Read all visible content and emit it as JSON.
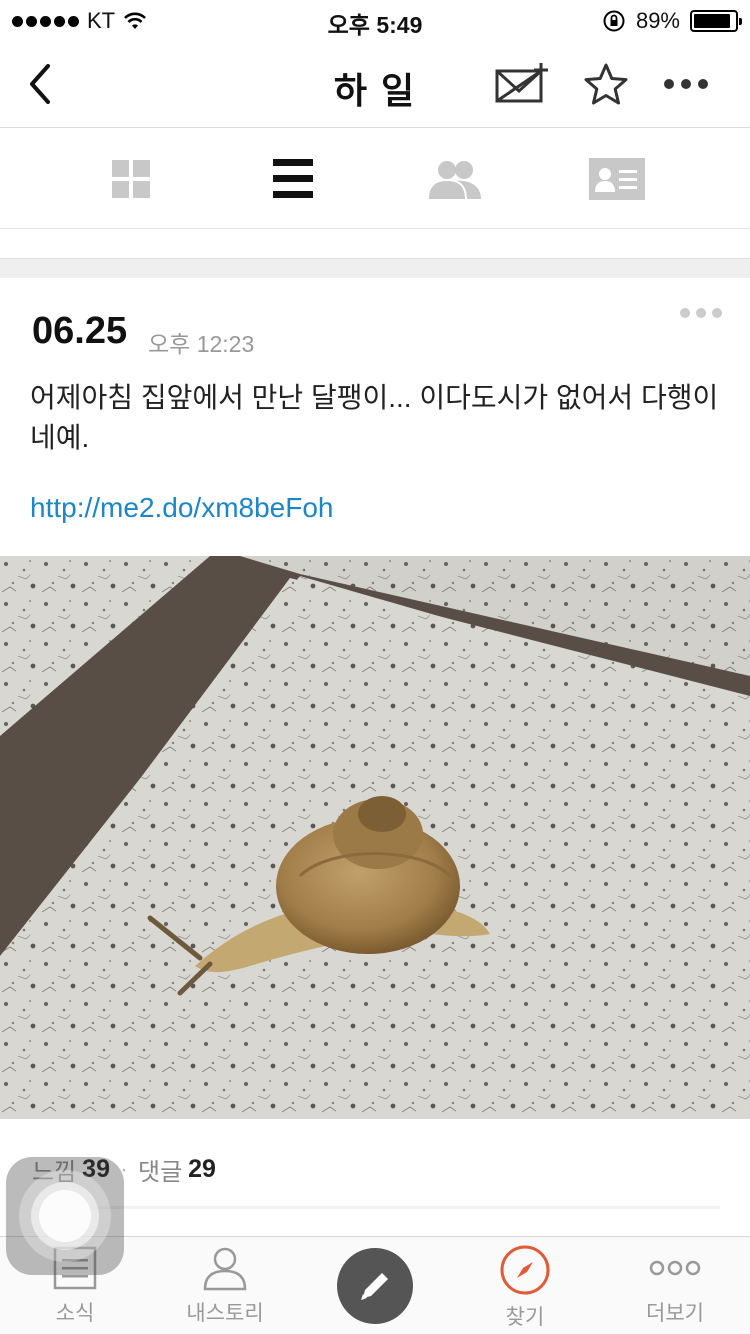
{
  "status_bar": {
    "carrier": "KT",
    "time": "오후 5:49",
    "battery": "89%",
    "battery_level": 0.89
  },
  "nav": {
    "title": "하 일",
    "icons": [
      "back-chevron-icon",
      "add-mail-icon",
      "star-icon",
      "more-horizontal-icon"
    ]
  },
  "tabs": {
    "icons": [
      "grid-icon",
      "list-icon",
      "friends-icon",
      "profile-card-icon"
    ],
    "active_index": 1
  },
  "post": {
    "date": "06.25",
    "time": "오후 12:23",
    "text": "어제아침 집앞에서 만난 달팽이... 이다도시가 없어서 다행이네예.",
    "link": "http://me2.do/xm8beFoh",
    "image_subject": "snail on stone tile"
  },
  "stats": {
    "likes_label": "느낌",
    "likes_count": "39",
    "comments_label": "댓글",
    "comments_count": "29"
  },
  "tabbar": {
    "items": [
      {
        "label": "소식",
        "icon": "news-icon"
      },
      {
        "label": "내스토리",
        "icon": "person-icon"
      },
      {
        "label": "",
        "icon": "pencil-icon"
      },
      {
        "label": "찾기",
        "icon": "compass-icon"
      },
      {
        "label": "더보기",
        "icon": "more-circles-icon"
      }
    ],
    "active_index": 3
  },
  "colors": {
    "accent": "#e35a38",
    "link": "#1b86c8",
    "icon_gray": "#c8c8c8"
  }
}
